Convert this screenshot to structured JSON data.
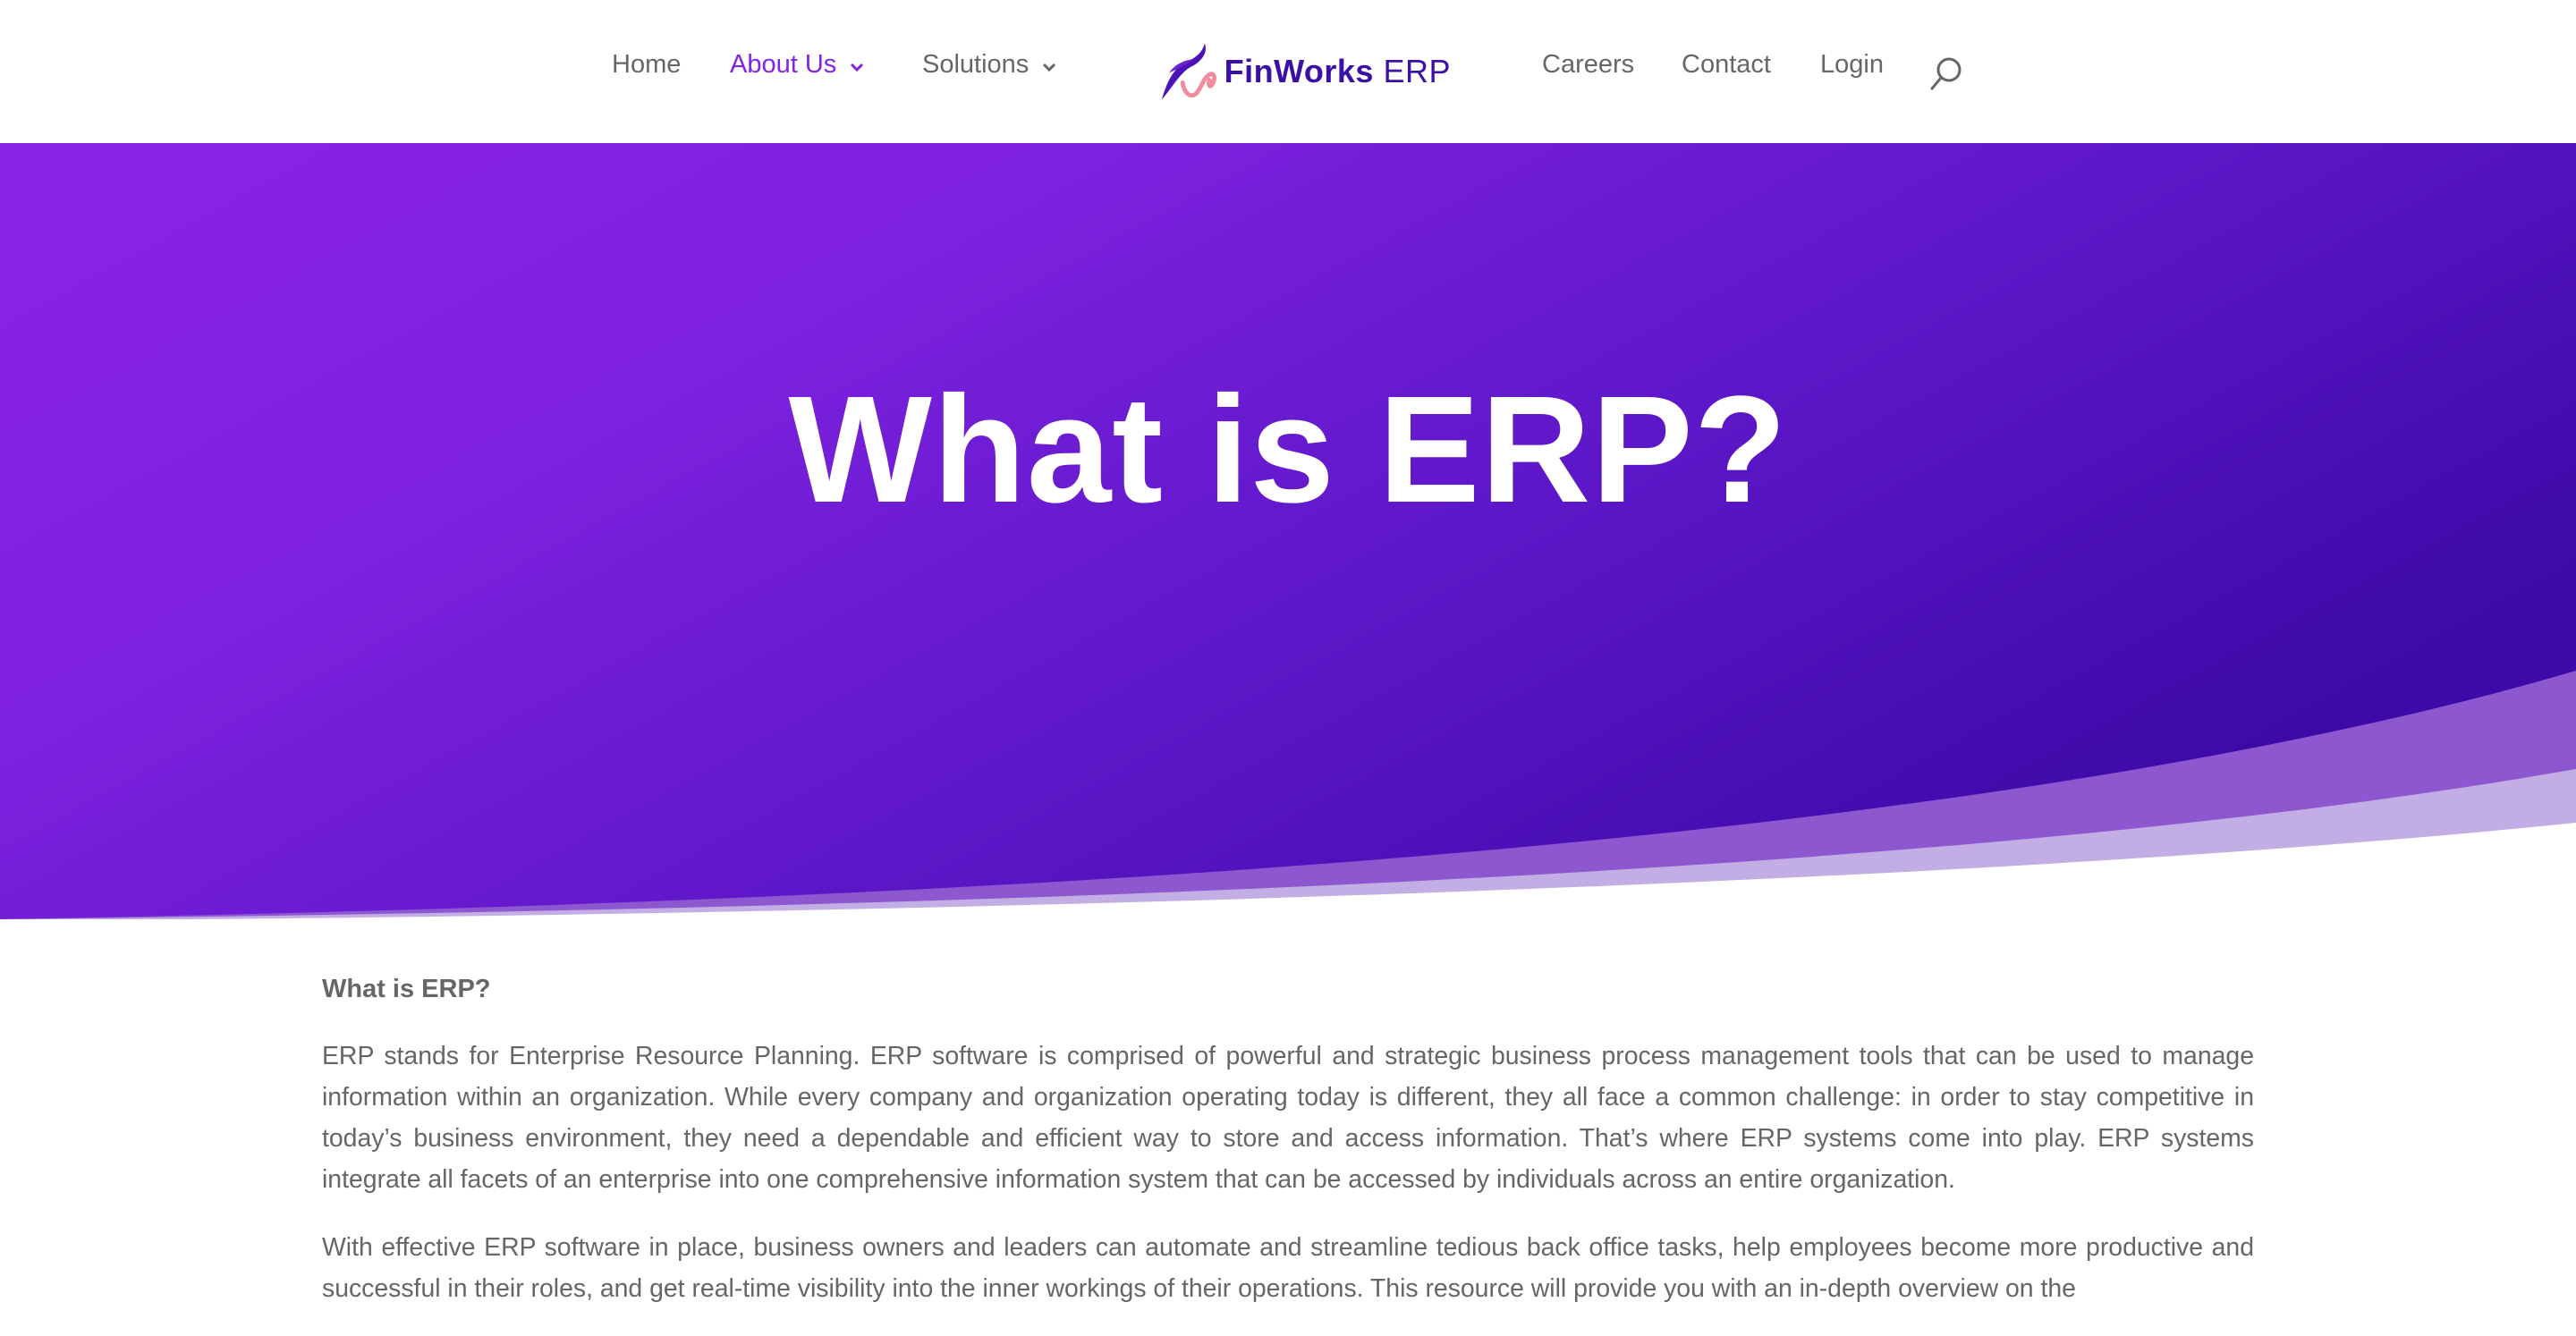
{
  "brand": {
    "name_bold": "FinWorks",
    "name_light": "ERP",
    "colors": {
      "primary": "#8224e3",
      "hero_dark": "#4510b0",
      "logo_navy": "#3b0fa8",
      "logo_pink": "#f28c9a",
      "text_gray": "#666666"
    }
  },
  "nav": {
    "left": [
      {
        "label": "Home",
        "active": false,
        "has_dropdown": false
      },
      {
        "label": "About Us",
        "active": true,
        "has_dropdown": true
      },
      {
        "label": "Solutions",
        "active": false,
        "has_dropdown": true
      }
    ],
    "right": [
      {
        "label": "Careers"
      },
      {
        "label": "Contact"
      },
      {
        "label": "Login"
      }
    ],
    "search_icon": "search-icon"
  },
  "hero": {
    "title": "What is ERP?"
  },
  "content": {
    "heading": "What is ERP?",
    "paragraphs": [
      "ERP stands for Enterprise Resource Planning. ERP software is comprised of powerful and strategic business process management tools that can be used to manage information within an organization. While every company and organization operating today is different, they all face a common challenge: in order to stay competitive in today’s business environment, they need a dependable and efficient way to store and access information. That’s where ERP systems come into play. ERP systems integrate all facets of an enterprise into one comprehensive information system that can be accessed by individuals across an entire organization.",
      "With effective ERP software in place, business owners and leaders can automate and streamline tedious back office tasks, help employees become more productive and successful in their roles, and get real-time visibility into the inner workings of their operations. This resource will provide you with an in-depth overview on the"
    ]
  }
}
